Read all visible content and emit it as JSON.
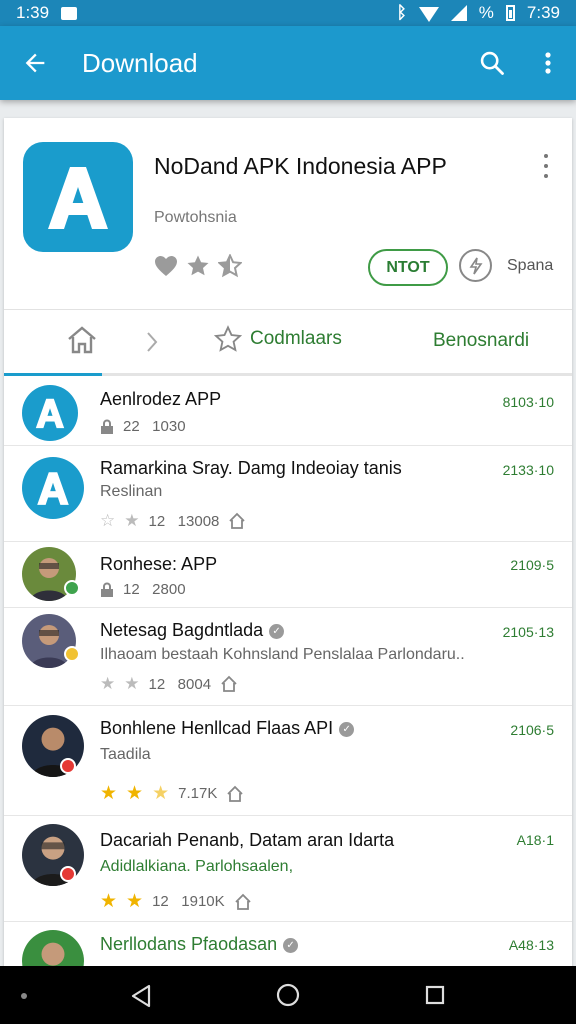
{
  "status": {
    "left_time": "1:39",
    "battery_pct": "%",
    "right_time": "7:39"
  },
  "appbar": {
    "title": "Download"
  },
  "app": {
    "title": "NoDand APK Indonesia APP",
    "publisher": "Powtohsnia",
    "install_label": "NTOT",
    "share_label": "Spana",
    "rating_stars": 2
  },
  "tabs": {
    "favorites": "Codmlaars",
    "recommended": "Benosnardi"
  },
  "items": [
    {
      "name": "Aenlrodez APP",
      "meta": "22   1030",
      "value": "8103·10"
    },
    {
      "name": "Ramarkina Sray. Damg Indeoiay tanis",
      "subtitle": "Reslinan",
      "meta": "12   13008",
      "value": "2133·10"
    },
    {
      "name": "Ronhese: APP",
      "meta": "12   2800",
      "value": "2109·5"
    },
    {
      "name": "Netesag Bagdntlada",
      "subtitle": "Ilhaoam bestaah Kohnsland Penslalaa Parlondaru..",
      "meta": "12   8004",
      "value": "2105·13"
    },
    {
      "name": "Bonhlene Henllcad Flaas API",
      "subtitle": "Taadila",
      "meta": "7.17K",
      "value": "2106·5"
    },
    {
      "name": "Dacariah Penanb, Datam aran Idarta",
      "subtitle": "Adidlalkiana. Parlohsaalen,",
      "meta": "12   1910K",
      "value": "A18·1"
    },
    {
      "name": "Nerllodans Pfaodasan",
      "value": "A48·13"
    }
  ]
}
